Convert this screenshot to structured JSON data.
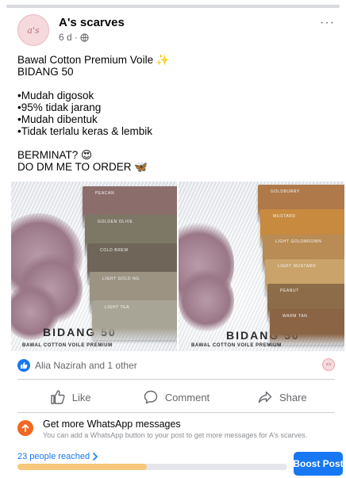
{
  "post": {
    "page_name": "A's scarves",
    "avatar_text": "a's",
    "time": "6 d",
    "time_separator": "·",
    "more_label": "···",
    "text": {
      "line1": "Bawal Cotton Premium Voile ✨",
      "line2": "BIDANG 50",
      "bullets": [
        "•Mudah digosok",
        "•95% tidak jarang",
        "•Mudah dibentuk",
        "•Tidak terlalu keras & lembik"
      ],
      "cta1": "BERMINAT? 😍",
      "cta2": "DO DM ME TO ORDER 🦋"
    },
    "photos": [
      {
        "title": "BIDANG 50",
        "subtitle": "BAWAL COTTON VOILE PREMIUM",
        "swatches": [
          {
            "label": "PEACAN",
            "color": "#8b6e6c"
          },
          {
            "label": "GOLDEN OLIVE",
            "color": "#7d7766"
          },
          {
            "label": "COLD BREW",
            "color": "#6f6659"
          },
          {
            "label": "LIGHT GOLD NG",
            "color": "#9c9383"
          },
          {
            "label": "LIGHT TEA",
            "color": "#a9a596"
          }
        ]
      },
      {
        "title": "BIDANG 50",
        "subtitle": "BAWAL COTTON VOILE PREMIUM",
        "swatches": [
          {
            "label": "GOLDBURRY",
            "color": "#b0794a"
          },
          {
            "label": "MUSTARD",
            "color": "#c88a3f"
          },
          {
            "label": "LIGHT GOLDBROWN",
            "color": "#b98c55"
          },
          {
            "label": "LIGHT MUSTARD",
            "color": "#c9a36a"
          },
          {
            "label": "PEANUT",
            "color": "#8d6d49"
          },
          {
            "label": "WARM TAN",
            "color": "#8a6445"
          }
        ]
      }
    ],
    "reactions": {
      "text": "Alia Nazirah and 1 other"
    },
    "actions": {
      "like": "Like",
      "comment": "Comment",
      "share": "Share"
    }
  },
  "promo": {
    "title": "Get more WhatsApp messages",
    "subtitle": "You can add a WhatsApp button to your post to get more messages for A's scarves."
  },
  "insights": {
    "reach_text": "23 people reached",
    "reach_progress": 0.48,
    "boost_label": "Boost Post"
  },
  "colors": {
    "accent": "#1877f2",
    "promo_icon": "#f26822",
    "progress_fill": "#f7c77b"
  }
}
